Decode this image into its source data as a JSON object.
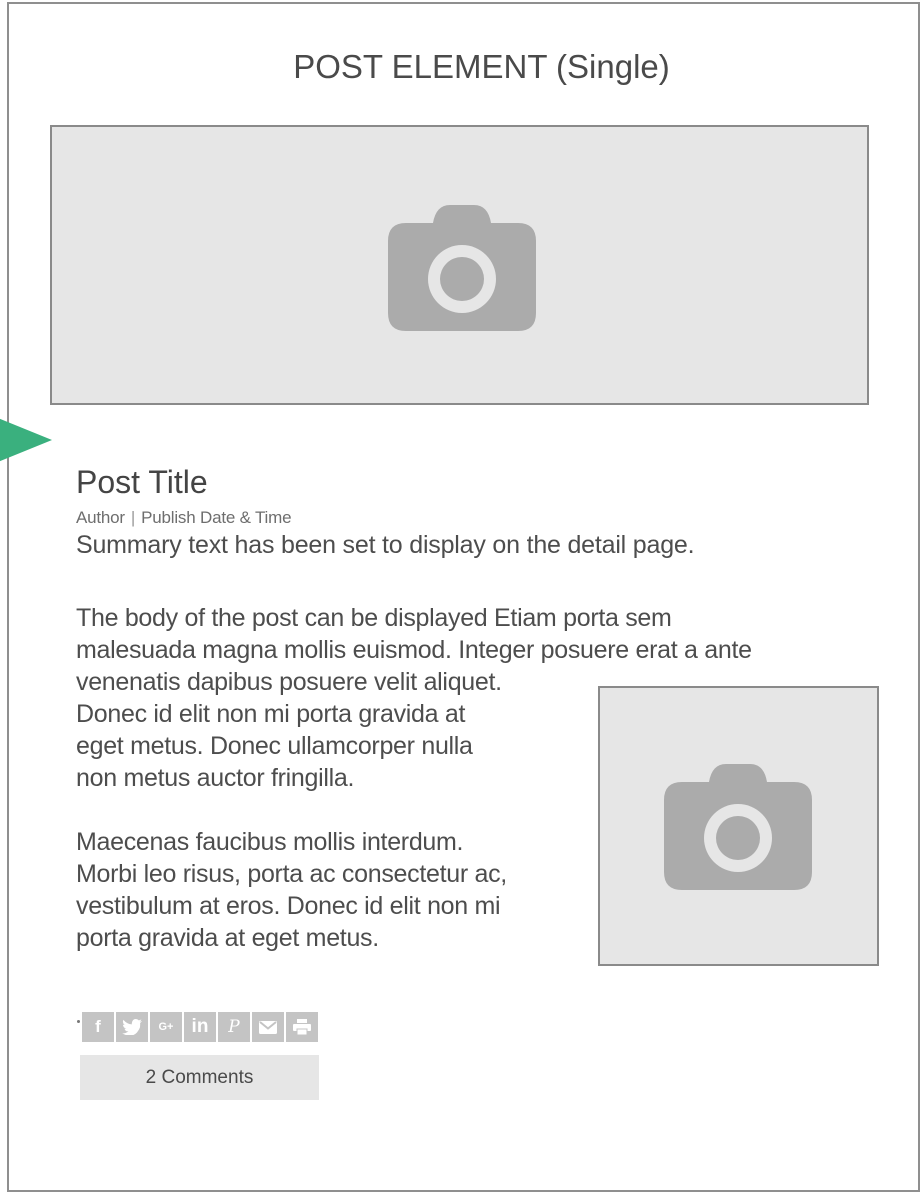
{
  "page": {
    "heading": "POST ELEMENT (Single)"
  },
  "images": {
    "hero_icon": "camera-icon",
    "inline_icon": "camera-icon",
    "placeholder_color": "#e6e6e6",
    "icon_color": "#ababab"
  },
  "indicator": {
    "color": "#3ab07e"
  },
  "post": {
    "title": "Post Title",
    "author": "Author",
    "separator": "|",
    "publish": "Publish Date & Time",
    "summary": "Summary text has been set to display on the detail page.",
    "body_lines": [
      "The body of the post can be displayed Etiam porta sem",
      "malesuada magna mollis euismod. Integer posuere erat a ante",
      "venenatis dapibus posuere velit aliquet.",
      "Donec id elit non mi porta gravida at",
      "eget metus. Donec ullamcorper nulla",
      "non metus auctor fringilla."
    ],
    "body_lines_2": [
      "Maecenas faucibus mollis interdum.",
      "Morbi leo risus, porta ac consectetur ac,",
      "vestibulum at eros. Donec id elit non mi",
      "porta gravida at eget metus."
    ]
  },
  "share": {
    "buttons": [
      {
        "icon": "facebook-icon",
        "glyph": "f"
      },
      {
        "icon": "twitter-icon",
        "glyph": ""
      },
      {
        "icon": "google-plus-icon",
        "glyph": "G+"
      },
      {
        "icon": "linkedin-icon",
        "glyph": "in"
      },
      {
        "icon": "pinterest-icon",
        "glyph": "P"
      },
      {
        "icon": "email-icon",
        "glyph": ""
      },
      {
        "icon": "print-icon",
        "glyph": ""
      }
    ]
  },
  "comments": {
    "label": "2 Comments"
  }
}
